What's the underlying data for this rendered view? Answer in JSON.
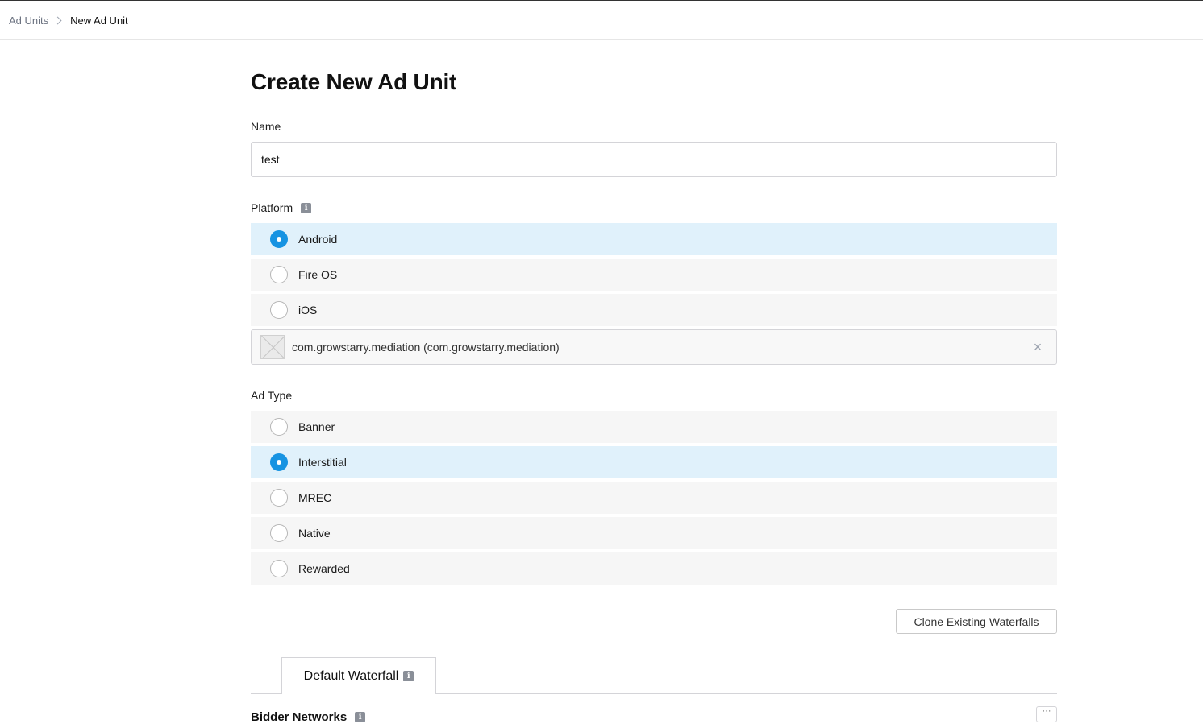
{
  "breadcrumb": {
    "parent": "Ad Units",
    "current": "New Ad Unit"
  },
  "page": {
    "title": "Create New Ad Unit"
  },
  "name_field": {
    "label": "Name",
    "value": "test"
  },
  "platform": {
    "label": "Platform",
    "info_icon": "info-icon",
    "options": [
      {
        "label": "Android",
        "selected": true
      },
      {
        "label": "Fire OS",
        "selected": false
      },
      {
        "label": "iOS",
        "selected": false
      }
    ],
    "app_selected": "com.growstarry.mediation (com.growstarry.mediation)",
    "clear_icon": "close-icon"
  },
  "ad_type": {
    "label": "Ad Type",
    "options": [
      {
        "label": "Banner",
        "selected": false
      },
      {
        "label": "Interstitial",
        "selected": true
      },
      {
        "label": "MREC",
        "selected": false
      },
      {
        "label": "Native",
        "selected": false
      },
      {
        "label": "Rewarded",
        "selected": false
      }
    ]
  },
  "actions": {
    "clone_label": "Clone Existing Waterfalls"
  },
  "tabs": [
    {
      "label": "Default Waterfall",
      "active": true
    }
  ],
  "section": {
    "bidder_label": "Bidder Networks"
  },
  "colors": {
    "selected_row": "#e0f1fb",
    "radio_accent": "#1693e2",
    "row_bg": "#f6f6f6"
  }
}
